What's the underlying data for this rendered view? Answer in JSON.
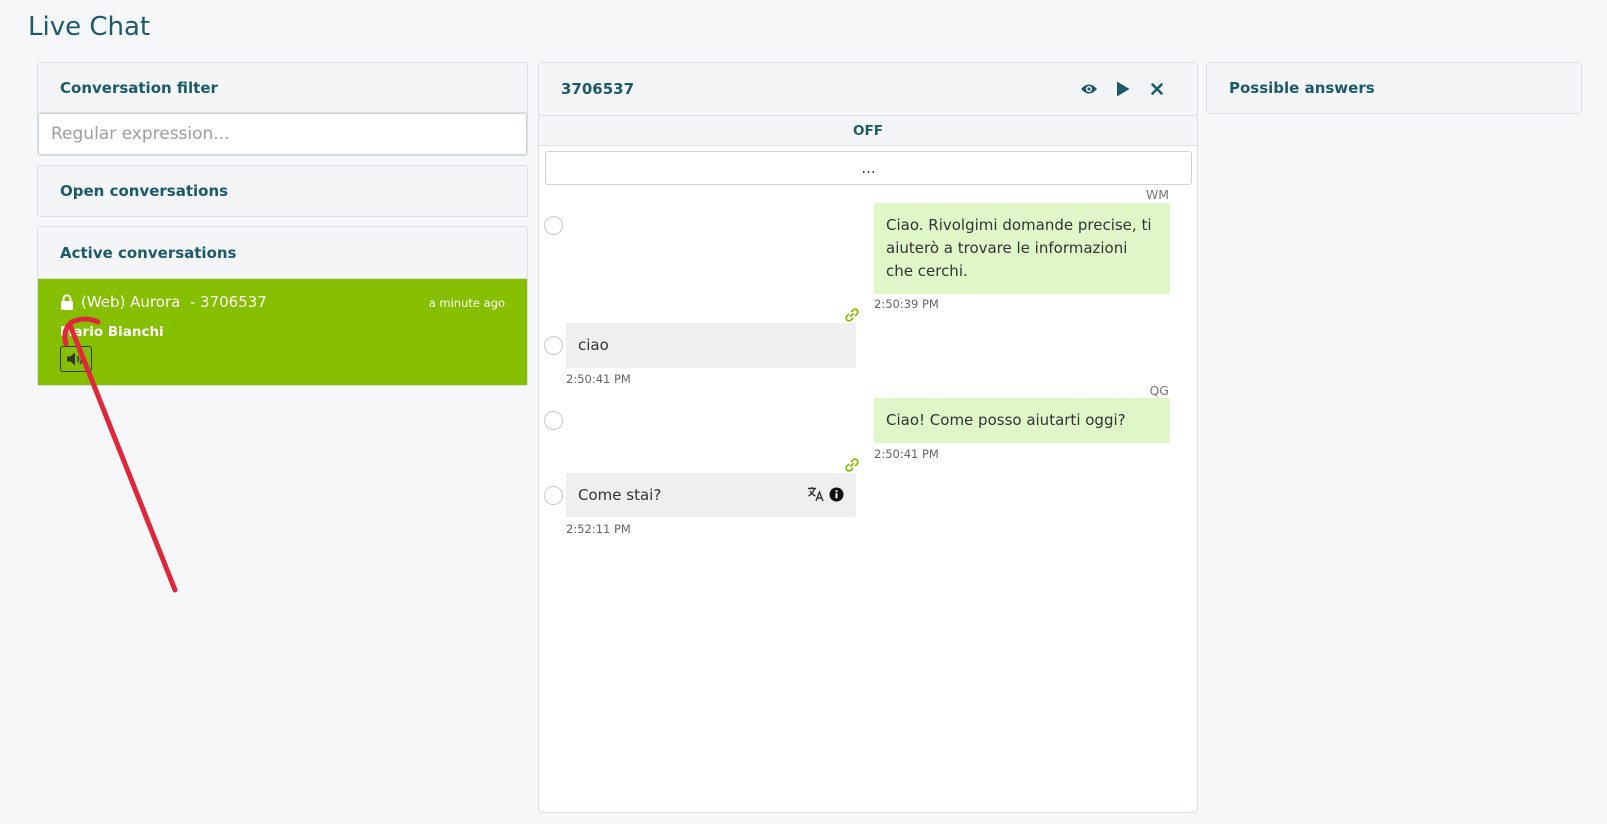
{
  "page": {
    "title": "Live Chat"
  },
  "filter": {
    "title": "Conversation filter",
    "placeholder": "Regular expression..."
  },
  "open_conversations": {
    "title": "Open conversations"
  },
  "active_conversations": {
    "title": "Active conversations",
    "items": [
      {
        "title": "(Web) Aurora  - 3706537",
        "time": "a minute ago",
        "name": "Mario Bianchi",
        "locked": true
      }
    ]
  },
  "chat": {
    "title": "3706537",
    "status": "OFF",
    "more_label": "...",
    "messages": [
      {
        "direction": "out",
        "author": "WM",
        "text": "Ciao. Rivolgimi domande precise, ti aiuterò a trovare le informazioni che cerchi.",
        "time": "2:50:39 PM"
      },
      {
        "direction": "in",
        "text": "ciao",
        "time": "2:50:41 PM"
      },
      {
        "direction": "out",
        "author": "QG",
        "text": "Ciao! Come posso aiutarti oggi?",
        "time": "2:50:41 PM"
      },
      {
        "direction": "in",
        "text": "Come stai?",
        "time": "2:52:11 PM"
      }
    ]
  },
  "answers": {
    "title": "Possible answers"
  },
  "colors": {
    "accent": "#1c5a6b",
    "active_item": "#86bf00",
    "outgoing_bubble": "#dff6c9",
    "incoming_bubble": "#efefef",
    "annotation": "#e0263a"
  },
  "icons": {
    "header": [
      "eye-icon",
      "play-icon",
      "close-icon"
    ],
    "conversation": [
      "lock-icon",
      "speaker-icon"
    ],
    "message": [
      "link-icon",
      "translate-icon",
      "info-icon"
    ]
  }
}
